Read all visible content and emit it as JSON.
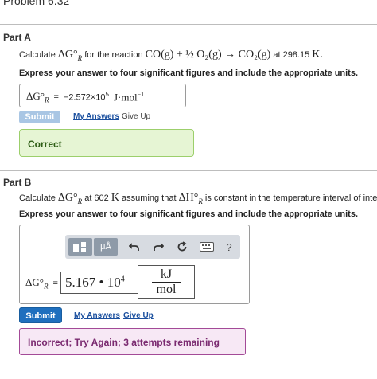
{
  "problem": {
    "title": "Problem 6.32"
  },
  "part_a": {
    "label": "Part A",
    "question": {
      "pre": "Calculate",
      "symbol": "ΔG°",
      "sub": "R",
      "mid": "for the reaction",
      "reaction": "CO(g) + ½ O₂(g) → CO₂(g)",
      "at": "at 298.15",
      "unit": "K."
    },
    "instruction": "Express your answer to four significant figures and include the appropriate units.",
    "answer": {
      "symbol": "ΔG°",
      "sub": "R",
      "eq": "=",
      "value_mantissa": "−2.572×10",
      "value_exp": "5",
      "unit": "J·mol",
      "unit_exp": "−1"
    },
    "buttons": {
      "submit": "Submit",
      "my_answers": "My Answers",
      "give_up": "Give Up"
    },
    "feedback": "Correct"
  },
  "part_b": {
    "label": "Part B",
    "question": {
      "pre": "Calculate",
      "symbol": "ΔG°",
      "sub": "R",
      "at": "at 602",
      "unit": "K",
      "mid": "assuming that",
      "symbol2": "ΔH°",
      "sub2": "R",
      "post": "is constant in the temperature interval of interest."
    },
    "instruction": "Express your answer to four significant figures and include the appropriate units.",
    "toolbar": {
      "units_label": "μÅ",
      "help": "?"
    },
    "answer": {
      "symbol": "ΔG°",
      "sub": "R",
      "eq": "=",
      "value": "5.167 • 10",
      "value_exp": "4",
      "unit_num": "kJ",
      "unit_den": "mol"
    },
    "buttons": {
      "submit": "Submit",
      "my_answers": "My Answers",
      "give_up": "Give Up"
    },
    "feedback": "Incorrect; Try Again; 3 attempts remaining"
  },
  "colors": {
    "correct_bg": "#e6f5d4",
    "incorrect_bg": "#f7e8f5",
    "submit_active": "#1f6fbe",
    "submit_disabled": "#a9c6e4",
    "link": "#1a4f9e"
  },
  "icons": [
    "templates-icon",
    "undo-icon",
    "redo-icon",
    "reset-icon",
    "keyboard-icon",
    "help-icon"
  ]
}
